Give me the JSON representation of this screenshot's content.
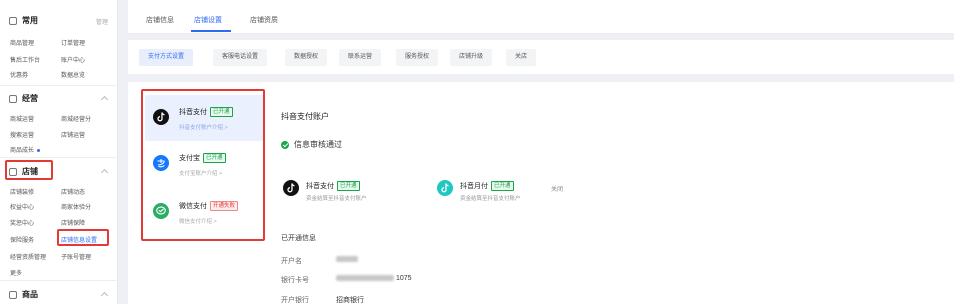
{
  "sidebar": {
    "common": {
      "title": "常用",
      "extra": "管理",
      "items": [
        "商品管理",
        "订单管理",
        "售后工作台",
        "账户中心",
        "优惠券",
        "数据总览"
      ]
    },
    "operations": {
      "title": "经营",
      "items": [
        "商城运营",
        "商城经营分",
        "搜索运营",
        "店铺运营",
        "商品成长"
      ]
    },
    "store": {
      "title": "店铺",
      "items": [
        "店铺装修",
        "店铺动态",
        "权益中心",
        "商家体验分",
        "奖惩中心",
        "店铺保障",
        "保险服务",
        "店铺信息设置",
        "经营资质管理",
        "子账号管理",
        "更多"
      ]
    },
    "goods": {
      "title": "商品"
    }
  },
  "top_tabs": [
    "店铺信息",
    "店铺设置",
    "店铺资质"
  ],
  "sub_tabs": [
    "支付方式设置",
    "客服电话设置",
    "数据授权",
    "联系运营",
    "服务授权",
    "店铺升级",
    "关店"
  ],
  "payment_methods": [
    {
      "name": "抖音支付",
      "badge": "已开通",
      "sub": "抖音支付账户介绍 >"
    },
    {
      "name": "支付宝",
      "badge": "已开通",
      "sub": "支付宝账户介绍 >"
    },
    {
      "name": "微信支付",
      "badge": "开通失败",
      "sub": "微信支付介绍 >"
    }
  ],
  "account": {
    "title": "抖音支付账户",
    "status": "信息审核通过",
    "cards": [
      {
        "name": "抖音支付",
        "badge": "已开通",
        "desc": "资金结算至抖音支付账户"
      },
      {
        "name": "抖音月付",
        "badge": "已开通",
        "desc": "资金结算至抖音支付账户",
        "action": "关闭"
      }
    ],
    "info_title": "已开通信息",
    "fields": [
      {
        "label": "开户名",
        "value": ""
      },
      {
        "label": "银行卡号",
        "value": "1075"
      },
      {
        "label": "开户银行",
        "value": "招商银行"
      }
    ]
  },
  "colors": {
    "accent": "#2f6bf0",
    "highlight": "#e23b36",
    "success": "#1aa54b"
  }
}
